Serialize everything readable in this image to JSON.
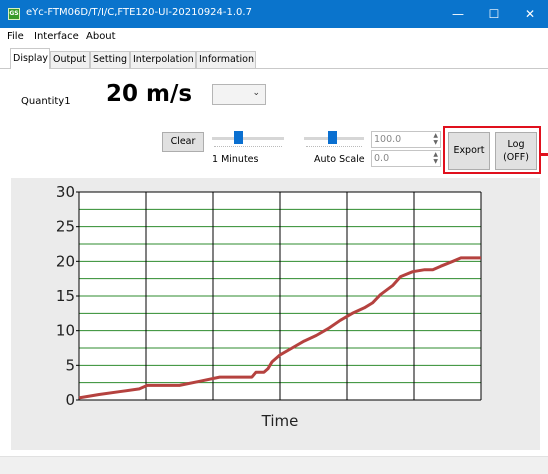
{
  "window": {
    "title": "eYc-FTM06D/T/I/C,FTE120-UI-20210924-1.0.7",
    "app_icon_text": "GS",
    "controls": {
      "minimize": "—",
      "maximize": "☐",
      "close": "✕"
    }
  },
  "menu": [
    "File",
    "Interface",
    "About"
  ],
  "tabs": [
    {
      "label": "Display",
      "active": true
    },
    {
      "label": "Output",
      "active": false
    },
    {
      "label": "Setting",
      "active": false
    },
    {
      "label": "Interpolation",
      "active": false
    },
    {
      "label": "Information",
      "active": false
    }
  ],
  "display": {
    "quantity_label": "Quantity1",
    "value": "20 m/s",
    "unit_combo_value": "",
    "clear_label": "Clear",
    "time_slider_caption": "1 Minutes",
    "scale_slider_caption": "Auto Scale",
    "scale_max": "100.0",
    "scale_min": "0.0",
    "export_label": "Export",
    "log_label_line1": "Log",
    "log_label_line2": "(OFF)"
  },
  "colors": {
    "titlebar": "#0a74cc",
    "accent": "#0a6fd0",
    "highlight": "#e0101d",
    "grid": "#2e8b2e",
    "series": "#b5423f",
    "chart_bg": "#ebebeb"
  },
  "chart_data": {
    "type": "line",
    "title": "",
    "xlabel": "Time",
    "ylabel": "",
    "ylim": [
      0,
      30
    ],
    "yticks": [
      "0",
      "5",
      "10",
      "15",
      "20",
      "25",
      "30"
    ],
    "grid": true,
    "series": [
      {
        "x": [
          0,
          0.05,
          0.1,
          0.15,
          0.17,
          0.2,
          0.25,
          0.3,
          0.35,
          0.38,
          0.4,
          0.43,
          0.44,
          0.46,
          0.47,
          0.48,
          0.5,
          0.53,
          0.56,
          0.59,
          0.62,
          0.65,
          0.68,
          0.71,
          0.73,
          0.75,
          0.78,
          0.8,
          0.83,
          0.86,
          0.88,
          0.9,
          0.93,
          0.95,
          1.0
        ],
        "y": [
          0.3,
          0.8,
          1.2,
          1.6,
          2.1,
          2.1,
          2.1,
          2.7,
          3.3,
          3.3,
          3.3,
          3.3,
          4.0,
          4.0,
          4.5,
          5.5,
          6.5,
          7.5,
          8.5,
          9.3,
          10.3,
          11.5,
          12.5,
          13.3,
          14.0,
          15.2,
          16.5,
          17.8,
          18.5,
          18.8,
          18.8,
          19.3,
          20.0,
          20.5,
          20.5
        ]
      }
    ]
  }
}
